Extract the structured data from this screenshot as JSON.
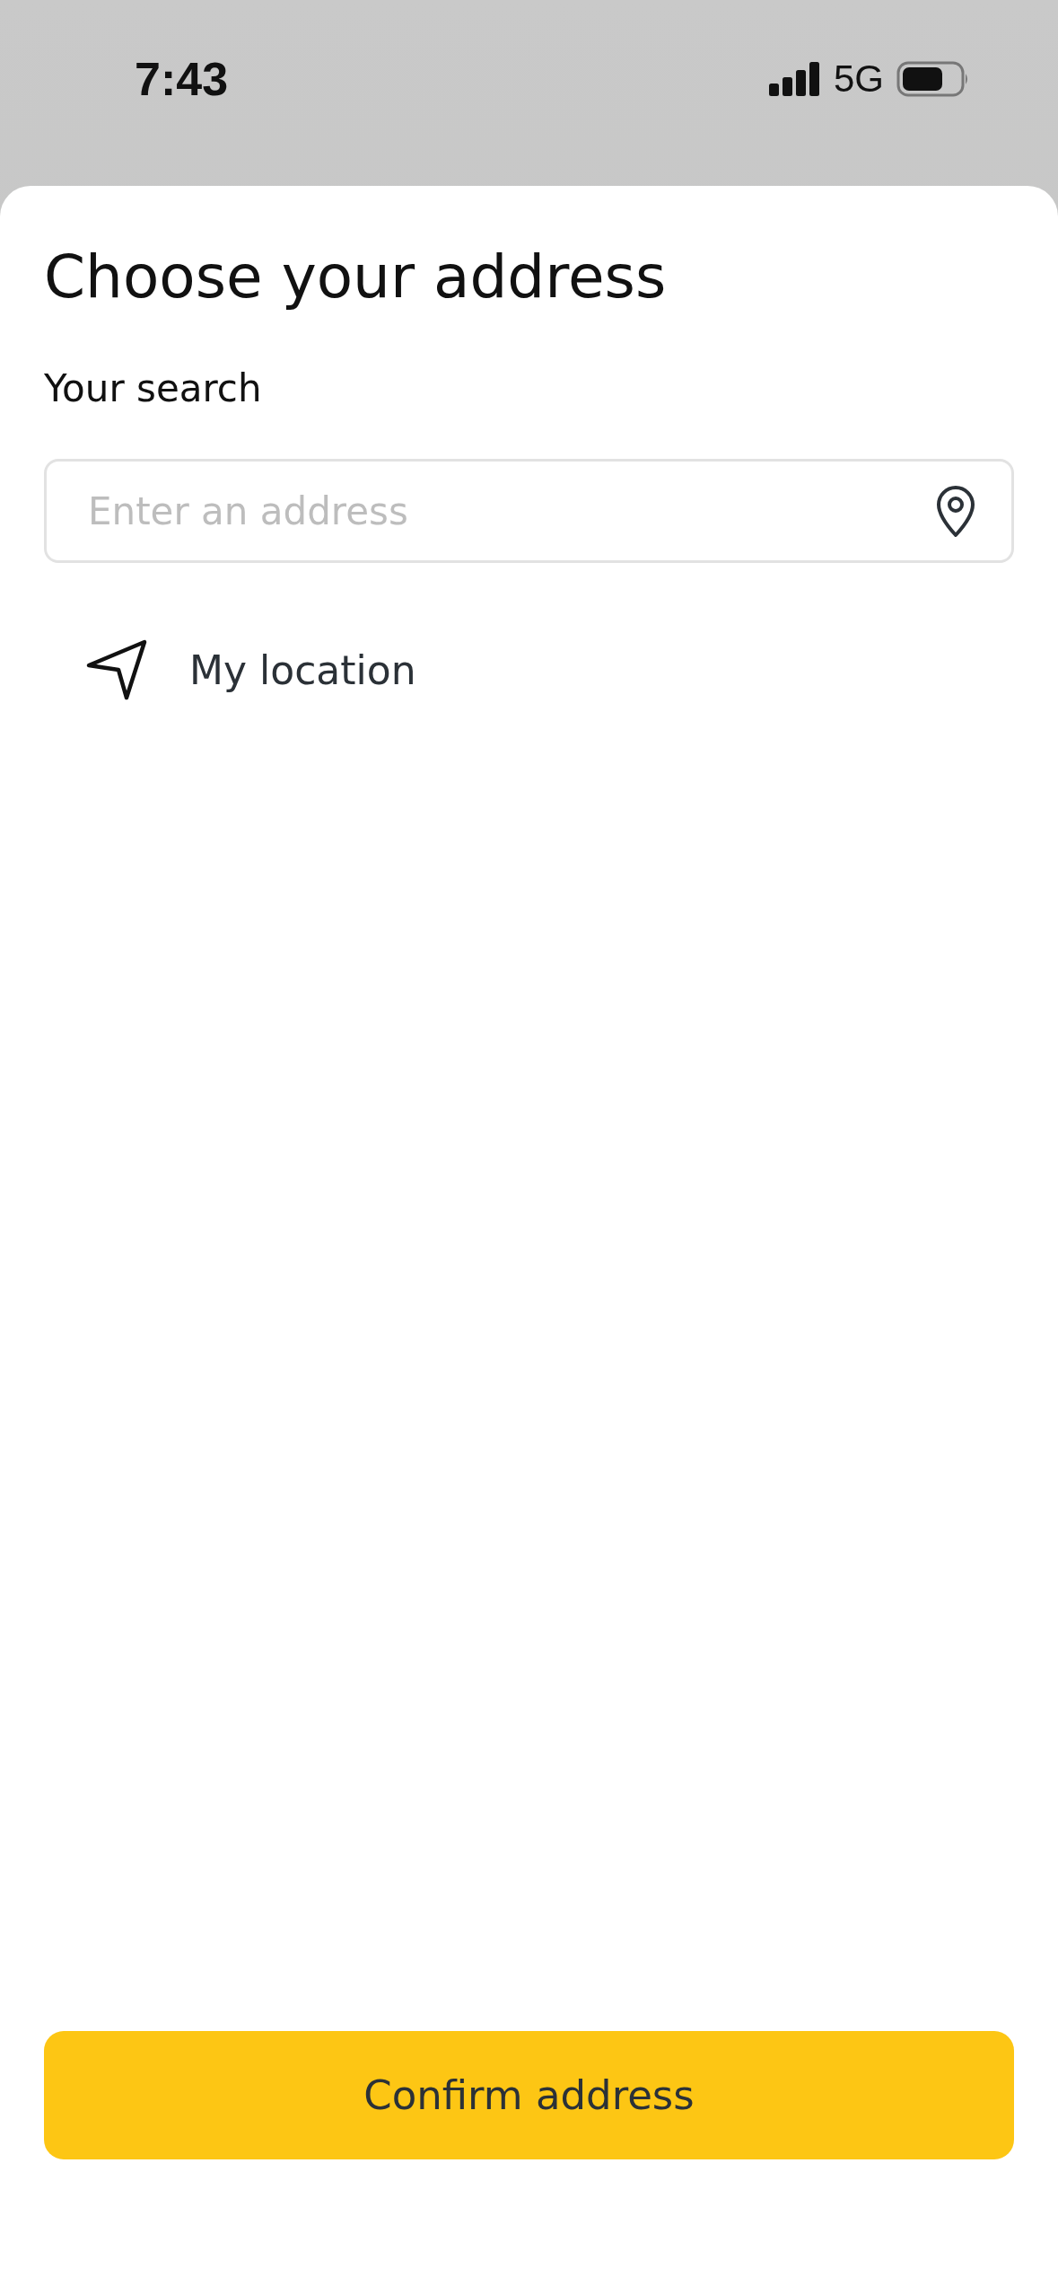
{
  "status_bar": {
    "time": "7:43",
    "network": "5G"
  },
  "sheet": {
    "title": "Choose your address",
    "search_label": "Your search",
    "search": {
      "placeholder": "Enter an address"
    },
    "options": [
      {
        "label": "My location"
      }
    ],
    "confirm_button": "Confirm address"
  }
}
